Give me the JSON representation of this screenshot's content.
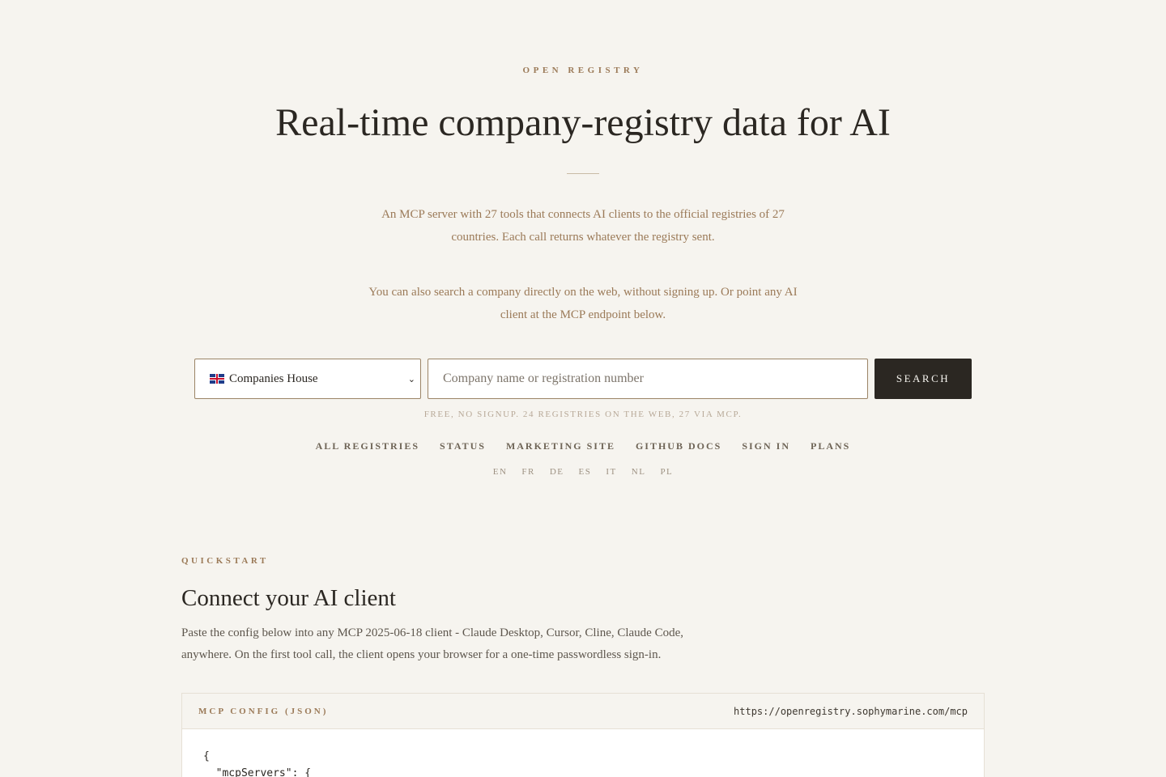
{
  "hero": {
    "eyebrow": "OPEN REGISTRY",
    "title": "Real-time company-registry data for AI",
    "lede_one": "An MCP server with 27 tools that connects AI clients to the official registries of 27 countries. Each call returns whatever the registry sent.",
    "lede_two": "You can also search a company directly on the web, without signing up. Or point any AI client at the MCP endpoint below."
  },
  "search": {
    "registry_selected": "Companies House",
    "registry_flag_icon": "uk-flag-icon",
    "input_placeholder": "Company name or registration number",
    "button_label": "SEARCH",
    "fine_print": "FREE, NO SIGNUP. 24 REGISTRIES ON THE WEB, 27 VIA MCP."
  },
  "nav": {
    "items": [
      {
        "label": "ALL REGISTRIES"
      },
      {
        "label": "STATUS"
      },
      {
        "label": "MARKETING SITE"
      },
      {
        "label": "GITHUB DOCS"
      },
      {
        "label": "SIGN IN"
      },
      {
        "label": "PLANS"
      }
    ]
  },
  "languages": {
    "items": [
      {
        "label": "EN"
      },
      {
        "label": "FR"
      },
      {
        "label": "DE"
      },
      {
        "label": "ES"
      },
      {
        "label": "IT"
      },
      {
        "label": "NL"
      },
      {
        "label": "PL"
      }
    ]
  },
  "quickstart": {
    "eyebrow": "QUICKSTART",
    "title": "Connect your AI client",
    "body": "Paste the config below into any MCP 2025-06-18 client - Claude Desktop, Cursor, Cline, Claude Code, anywhere. On the first tool call, the client opens your browser for a one-time passwordless sign-in."
  },
  "config": {
    "label": "MCP CONFIG (JSON)",
    "url": "https://openregistry.sophymarine.com/mcp",
    "code": "{\n  \"mcpServers\": {"
  },
  "colors": {
    "background": "#f6f4ef",
    "accent": "#9b7a58",
    "ink": "#2b2722"
  }
}
